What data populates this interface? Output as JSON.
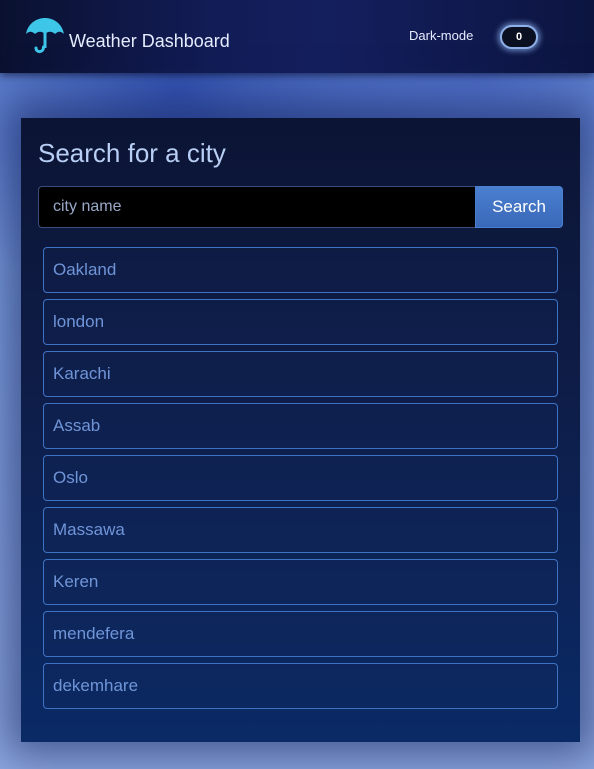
{
  "navbar": {
    "brand_icon": "umbrella-icon",
    "brand_title": "Weather Dashboard",
    "dark_mode_label": "Dark-mode",
    "dark_mode_value": "0",
    "accent_color": "#3ec6e8"
  },
  "search": {
    "heading": "Search for a city",
    "placeholder": "city name",
    "value": "",
    "button_label": "Search"
  },
  "history": {
    "cities": [
      "Oakland",
      "london",
      "Karachi",
      "Assab",
      "Oslo",
      "Massawa",
      "Keren",
      "mendefera",
      "dekemhare"
    ]
  }
}
